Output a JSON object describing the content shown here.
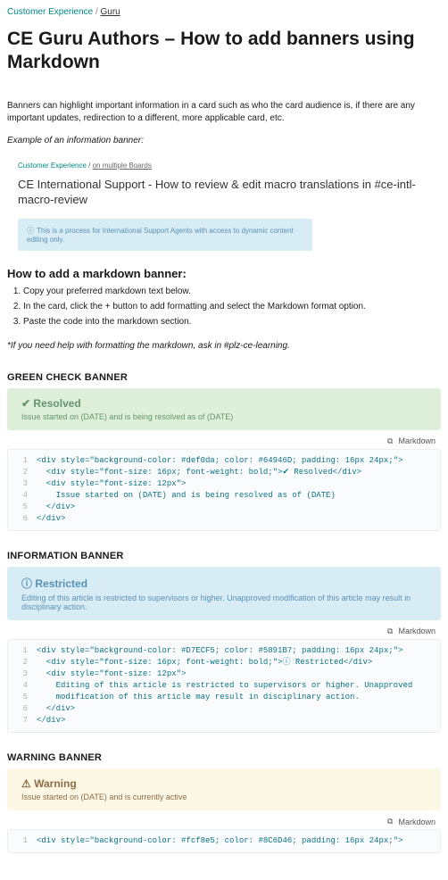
{
  "breadcrumb": {
    "item1": "Customer Experience",
    "sep": "/",
    "item2": "Guru"
  },
  "title": "CE Guru Authors – How to add banners using Markdown",
  "intro": "Banners can highlight important information in a card such as who the card audience is, if there are any important updates, redirection to a different, more applicable card, etc.",
  "example_label": "Example of an information banner:",
  "example": {
    "crumb1": "Customer Experience",
    "crumb_sep": " / ",
    "crumb2": "on multiple Boards",
    "heading": "CE International Support - How to review & edit macro translations in #ce-intl-macro-review",
    "info_glyph": "ⓘ",
    "info_text": "This is a process for International Support Agents with access to dynamic content editing only."
  },
  "howto_heading": "How to add a markdown banner:",
  "steps": [
    "Copy your preferred markdown text below.",
    "In the card, click the + button to add formatting and select the Markdown format option.",
    "Paste the code into the markdown section."
  ],
  "help_note": "*If you need help with formatting the markdown, ask in #plz-ce-learning.",
  "code_header": {
    "lang": "Markdown"
  },
  "sections": {
    "green": {
      "heading": "GREEN CHECK BANNER",
      "banner_icon": "✔",
      "banner_title": "Resolved",
      "banner_sub": "Issue started on (DATE) and is being resolved as of (DATE)",
      "code": "<div style=\"background-color: #def0da; color: #64946D; padding: 16px 24px;\">\n  <div style=\"font-size: 16px; font-weight: bold;\">✔ Resolved</div>\n  <div style=\"font-size: 12px\">\n    Issue started on (DATE) and is being resolved as of (DATE)\n  </div>\n</div>"
    },
    "blue": {
      "heading": "INFORMATION BANNER",
      "banner_icon": "ⓘ",
      "banner_title": "Restricted",
      "banner_sub": "Editing of this article is restricted to supervisors or higher. Unapproved modification of this article may result in disciplinary action.",
      "code": "<div style=\"background-color: #D7ECF5; color: #5891B7; padding: 16px 24px;\">\n  <div style=\"font-size: 16px; font-weight: bold;\">ⓘ Restricted</div>\n  <div style=\"font-size: 12px\">\n    Editing of this article is restricted to supervisors or higher. Unapproved\n    modification of this article may result in disciplinary action.\n  </div>\n</div>"
    },
    "yellow": {
      "heading": "WARNING BANNER",
      "banner_icon": "⚠",
      "banner_title": "Warning",
      "banner_sub": "Issue started on (DATE) and is currently active",
      "code": "<div style=\"background-color: #fcf8e5; color: #8C6D46; padding: 16px 24px;\">"
    }
  }
}
